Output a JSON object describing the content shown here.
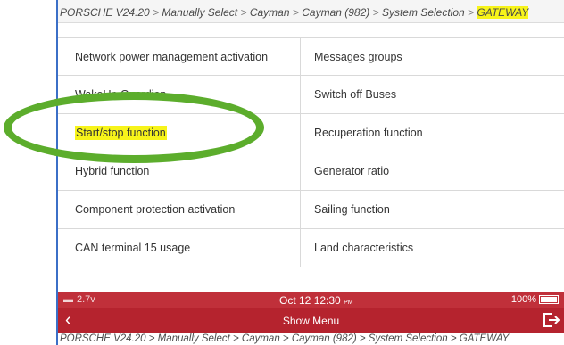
{
  "breadcrumb": {
    "brand": "PORSCHE V24.20",
    "items": [
      "Manually Select",
      "Cayman",
      "Cayman (982)",
      "System Selection",
      "GATEWAY"
    ],
    "separator": ">"
  },
  "functions": [
    {
      "left": "Network power management activation",
      "right": "Messages groups"
    },
    {
      "left": "WakeUp Guardian",
      "right": "Switch off Buses"
    },
    {
      "left": "Start/stop function",
      "right": "Recuperation function"
    },
    {
      "left": "Hybrid function",
      "right": "Generator ratio"
    },
    {
      "left": "Component protection activation",
      "right": "Sailing function"
    },
    {
      "left": "CAN terminal 15 usage",
      "right": "Land characteristics"
    }
  ],
  "highlighted_item": "Start/stop function",
  "status": {
    "voltage": "2.7v",
    "date": "Oct 12",
    "time": "12:30",
    "ampm": "PM",
    "battery": "100%",
    "battery_level": 1.0
  },
  "nav": {
    "back_icon": "chevron-left-icon",
    "menu_label": "Show Menu",
    "exit_icon": "exit-icon"
  },
  "footer_breadcrumb": "PORSCHE V24.20 > Manually Select > Cayman > Cayman (982) > System Selection > GATEWAY",
  "colors": {
    "highlight": "#f7f41a",
    "status_bar": "#c0303a",
    "nav_bar": "#b5232e",
    "annotation_ring": "#5cad2c"
  }
}
